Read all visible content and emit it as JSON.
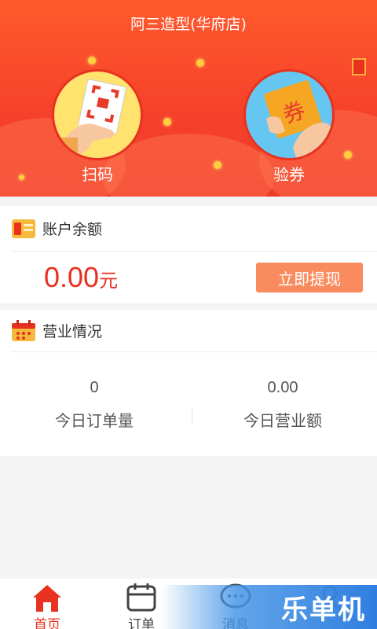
{
  "header": {
    "store_name": "阿三造型(华府店)",
    "actions": [
      {
        "label": "扫码",
        "icon": "qr-scan-icon"
      },
      {
        "label": "验券",
        "icon": "coupon-ticket-icon"
      }
    ]
  },
  "account": {
    "title": "账户余额",
    "icon": "wallet-icon",
    "balance": "0.00",
    "unit": "元",
    "withdraw_label": "立即提现"
  },
  "business": {
    "title": "营业情况",
    "icon": "calendar-icon",
    "stats": [
      {
        "value": "0",
        "label": "今日订单量"
      },
      {
        "value": "0.00",
        "label": "今日营业额"
      }
    ]
  },
  "tabbar": {
    "tabs": [
      {
        "label": "首页",
        "icon": "home-icon",
        "active": true
      },
      {
        "label": "订单",
        "icon": "order-icon",
        "active": false
      },
      {
        "label": "消息",
        "icon": "message-icon",
        "active": false
      },
      {
        "label": "",
        "icon": "profile-icon",
        "active": false
      }
    ]
  },
  "watermark": {
    "text": "乐单机"
  },
  "colors": {
    "primary": "#f5412b",
    "accent_button": "#f98b5e",
    "amount": "#e8311f",
    "coin": "#ffcf3a"
  }
}
